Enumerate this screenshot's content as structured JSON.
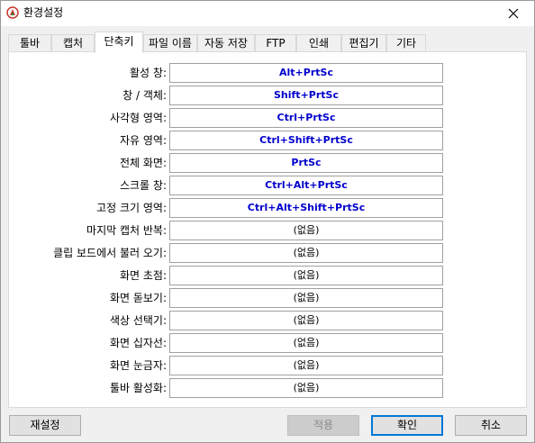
{
  "window": {
    "title": "환경설정",
    "icon": "app-logo-icon",
    "close_icon": "close-icon"
  },
  "tabs": [
    {
      "label": "툴바",
      "active": false
    },
    {
      "label": "캡처",
      "active": false
    },
    {
      "label": "단축키",
      "active": true
    },
    {
      "label": "파일 이름",
      "active": false
    },
    {
      "label": "자동 저장",
      "active": false
    },
    {
      "label": "FTP",
      "active": false
    },
    {
      "label": "인쇄",
      "active": false
    },
    {
      "label": "편집기",
      "active": false
    },
    {
      "label": "기타",
      "active": false
    }
  ],
  "shortcuts": [
    {
      "label": "활성 창:",
      "value": "Alt+PrtSc"
    },
    {
      "label": "창 / 객체:",
      "value": "Shift+PrtSc"
    },
    {
      "label": "사각형 영역:",
      "value": "Ctrl+PrtSc"
    },
    {
      "label": "자유 영역:",
      "value": "Ctrl+Shift+PrtSc"
    },
    {
      "label": "전체 화면:",
      "value": "PrtSc"
    },
    {
      "label": "스크롤 창:",
      "value": "Ctrl+Alt+PrtSc"
    },
    {
      "label": "고정 크기 영역:",
      "value": "Ctrl+Alt+Shift+PrtSc"
    },
    {
      "label": "마지막 캡처 반복:",
      "value": "(없음)"
    },
    {
      "label": "클립 보드에서 불러 오기:",
      "value": "(없음)"
    },
    {
      "label": "화면 초점:",
      "value": "(없음)"
    },
    {
      "label": "화면 돋보기:",
      "value": "(없음)"
    },
    {
      "label": "색상 선택기:",
      "value": "(없음)"
    },
    {
      "label": "화면 십자선:",
      "value": "(없음)"
    },
    {
      "label": "화면 눈금자:",
      "value": "(없음)"
    },
    {
      "label": "툴바 활성화:",
      "value": "(없음)"
    }
  ],
  "buttons": {
    "reset": "재설정",
    "apply": "적용",
    "ok": "확인",
    "cancel": "취소"
  },
  "colors": {
    "assigned_shortcut": "#0000cc",
    "default_button_border": "#0078d7"
  }
}
